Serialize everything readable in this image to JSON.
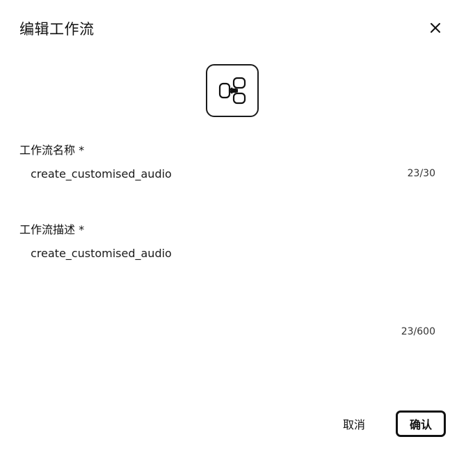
{
  "dialog": {
    "title": "编辑工作流",
    "close_icon": "close-icon",
    "workflow_icon": "workflow-share-icon"
  },
  "form": {
    "name_label": "工作流名称 *",
    "name_value": "create_customised_audio",
    "name_counter": "23/30",
    "description_label": "工作流描述 *",
    "description_value": "create_customised_audio",
    "description_counter": "23/600"
  },
  "footer": {
    "cancel_label": "取消",
    "confirm_label": "确认"
  }
}
